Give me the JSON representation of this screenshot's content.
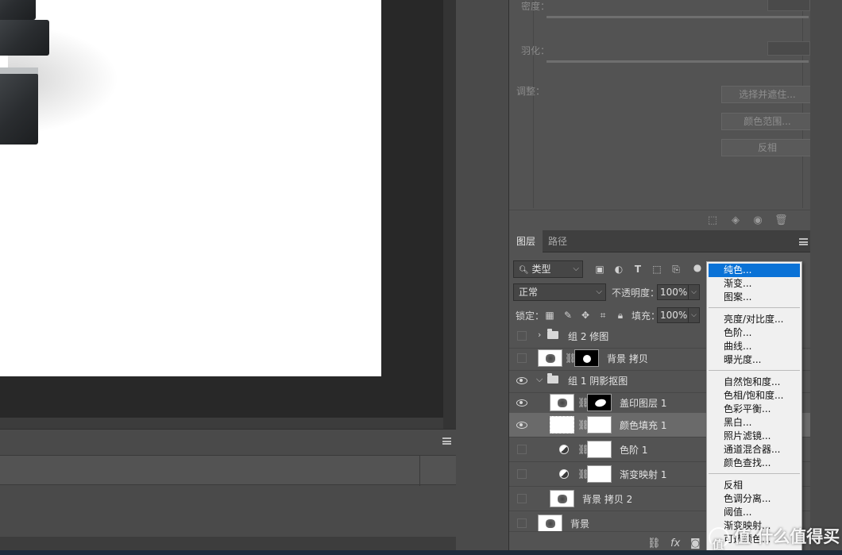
{
  "properties": {
    "density_label": "密度：",
    "feather_label": "羽化：",
    "adjust_label": "调整：",
    "buttons": [
      "选择并遮住...",
      "颜色范围...",
      "反相"
    ]
  },
  "layers_panel": {
    "tabs": [
      "图层",
      "路径"
    ],
    "filter_type": "类型",
    "blend_mode": "正常",
    "opacity_label": "不透明度：",
    "opacity_value": "100%",
    "lock_label": "锁定：",
    "fill_label": "填充：",
    "fill_value": "100%",
    "layers": [
      {
        "name": "组 2 修图",
        "visible": false,
        "kind": "group-collapsed"
      },
      {
        "name": "背景 拷贝",
        "visible": false,
        "kind": "image-mask"
      },
      {
        "name": "组 1 阴影抠图",
        "visible": true,
        "kind": "group-open"
      },
      {
        "name": "盖印图层 1",
        "visible": true,
        "kind": "smart-mask"
      },
      {
        "name": "颜色填充 1",
        "visible": true,
        "kind": "fill",
        "selected": true
      },
      {
        "name": "色阶 1",
        "visible": false,
        "kind": "adjustment"
      },
      {
        "name": "渐变映射 1",
        "visible": false,
        "kind": "adjustment"
      },
      {
        "name": "背景 拷贝 2",
        "visible": false,
        "kind": "image"
      },
      {
        "name": "背景",
        "visible": false,
        "kind": "image"
      }
    ],
    "bottom_icons": [
      "link-icon",
      "fx-icon",
      "mask-icon"
    ]
  },
  "adjustment_menu": {
    "group1": [
      "纯色...",
      "渐变...",
      "图案..."
    ],
    "group2": [
      "亮度/对比度...",
      "色阶...",
      "曲线...",
      "曝光度..."
    ],
    "group3": [
      "自然饱和度...",
      "色相/饱和度...",
      "色彩平衡...",
      "黑白...",
      "照片滤镜...",
      "通道混合器...",
      "颜色查找..."
    ],
    "group4": [
      "反相",
      "色调分离...",
      "阈值...",
      "渐变映射...",
      "可选颜色..."
    ],
    "highlighted": "纯色..."
  },
  "watermark": "值 什么值得买",
  "colors": {
    "menu_highlight": "#0a72d6",
    "panel_bg": "#535353",
    "canvas_bg": "#282828"
  }
}
